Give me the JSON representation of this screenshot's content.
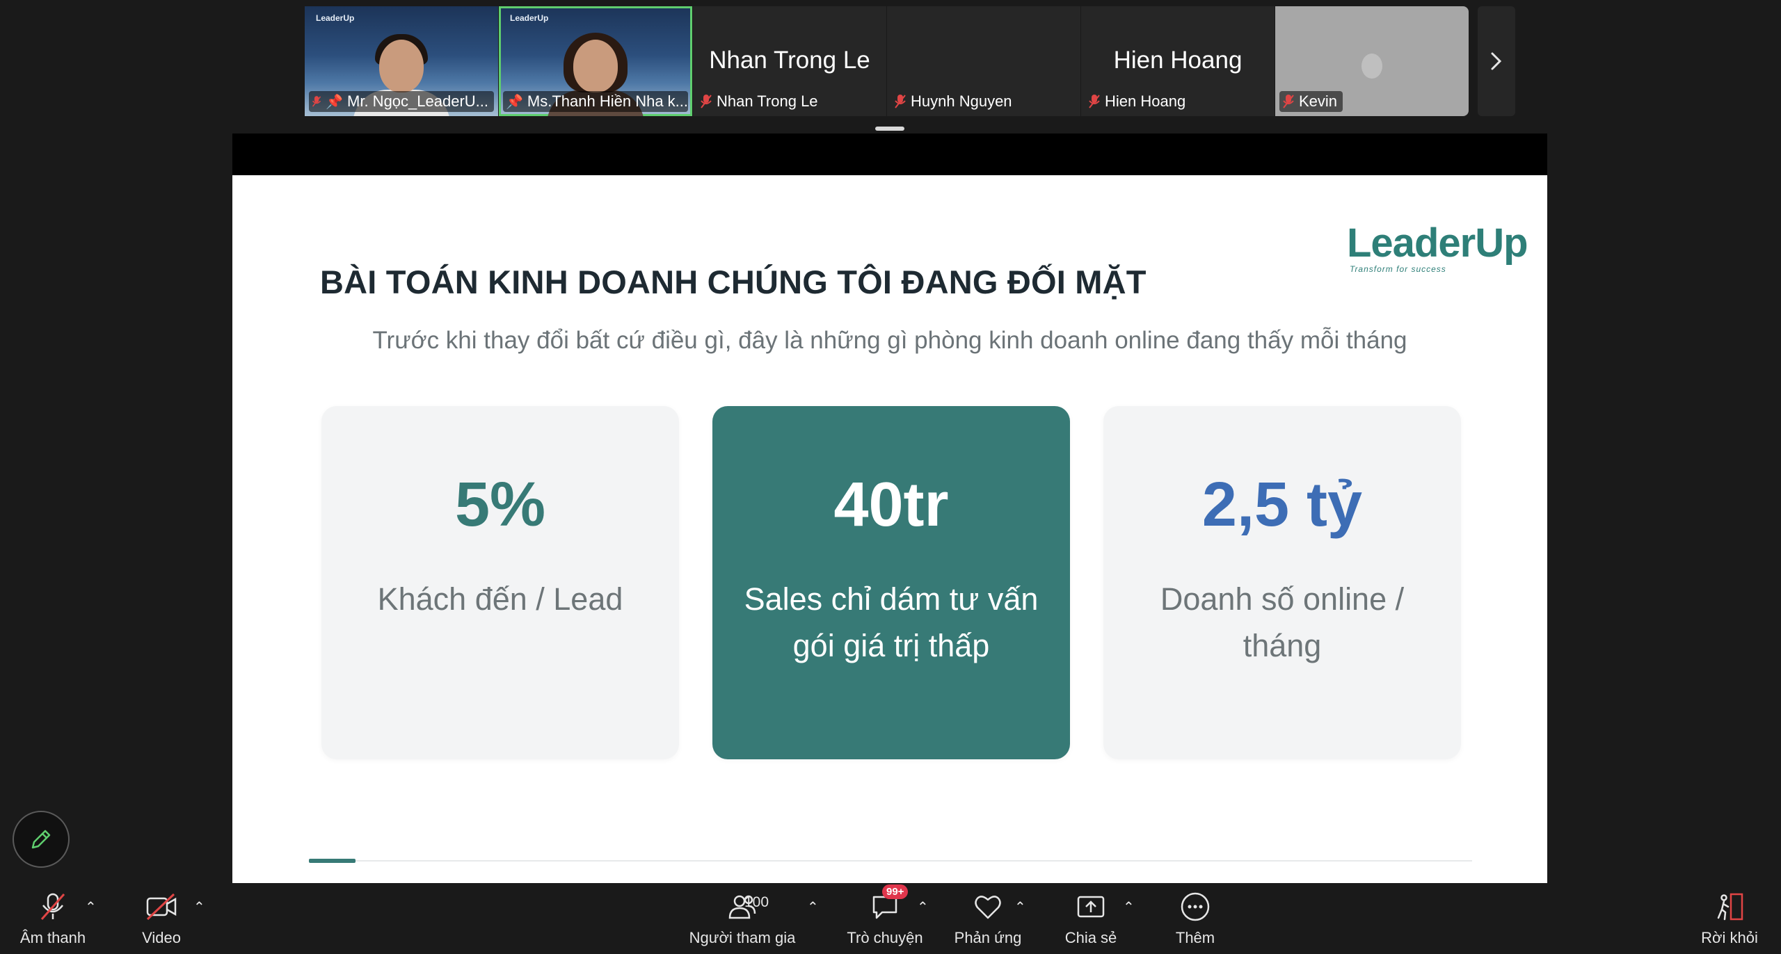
{
  "participants": [
    {
      "name": "Mr. Ngọc_LeaderU...",
      "pinned": true,
      "has_video": true,
      "active": false,
      "logo": "LeaderUp"
    },
    {
      "name": "Ms.Thanh Hiền Nha k...",
      "pinned": true,
      "has_video": true,
      "active": true,
      "logo": "LeaderUp"
    },
    {
      "name": "Nhan Trong Le",
      "display_name": "Nhan Trong Le",
      "has_video": false
    },
    {
      "name": "Huynh Nguyen",
      "has_video": false
    },
    {
      "name": "Hien Hoang",
      "display_name": "Hien Hoang",
      "has_video": false
    },
    {
      "name": "Kevin",
      "has_video": false
    }
  ],
  "slide": {
    "title": "BÀI TOÁN KINH DOANH CHÚNG TÔI ĐANG ĐỐI MẶT",
    "subtitle": "Trước khi thay đổi bất cứ điều gì, đây là những gì phòng kinh doanh online đang thấy mỗi tháng",
    "brand": {
      "name": "LeaderUp",
      "tagline": "Transform for success"
    },
    "cards": [
      {
        "value": "5%",
        "desc": "Khách đến / Lead",
        "value_color": "#377a76",
        "highlight": false
      },
      {
        "value": "40tr",
        "desc": "Sales chỉ dám tư vấn gói giá trị thấp",
        "value_color": "#ffffff",
        "highlight": true
      },
      {
        "value": "2,5 tỷ",
        "desc": "Doanh số online / tháng",
        "value_color": "#3d6db5",
        "highlight": false
      }
    ],
    "progress": 0.04
  },
  "toolbar": {
    "audio_label": "Âm thanh",
    "video_label": "Video",
    "participants_label": "Người tham gia",
    "participants_count": "100",
    "chat_label": "Trò chuyện",
    "chat_badge": "99+",
    "reactions_label": "Phản ứng",
    "share_label": "Chia sẻ",
    "more_label": "Thêm",
    "leave_label": "Rời khỏi"
  },
  "colors": {
    "accent_green": "#5fce6e",
    "teal": "#377a76",
    "blue_value": "#3d6db5",
    "badge_red": "#e0364c",
    "muted_red": "#e04545"
  }
}
